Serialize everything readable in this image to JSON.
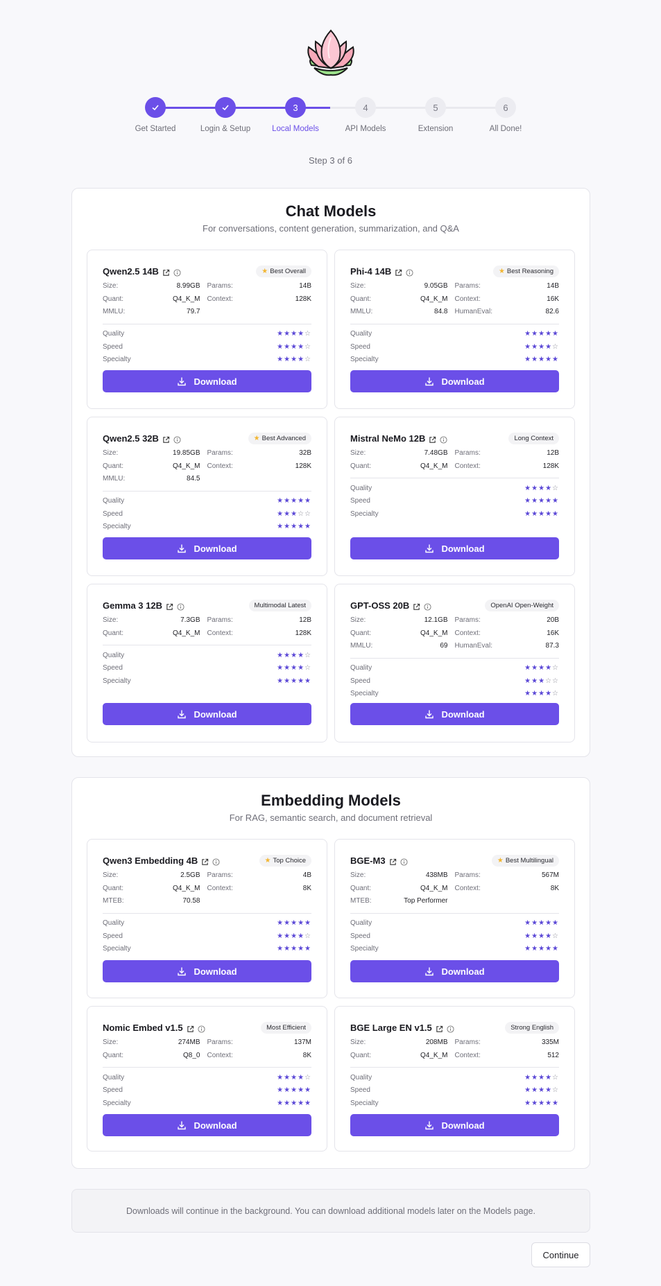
{
  "logo": {
    "icon": "lotus-logo-icon"
  },
  "stepper": {
    "steps": [
      {
        "number": "1",
        "label": "Get Started",
        "state": "done"
      },
      {
        "number": "2",
        "label": "Login & Setup",
        "state": "done"
      },
      {
        "number": "3",
        "label": "Local Models",
        "state": "active"
      },
      {
        "number": "4",
        "label": "API Models",
        "state": "todo"
      },
      {
        "number": "5",
        "label": "Extension",
        "state": "todo"
      },
      {
        "number": "6",
        "label": "All Done!",
        "state": "todo"
      }
    ],
    "step_text": "Step 3 of 6"
  },
  "colors": {
    "accent": "#6b4fe8",
    "star": "#5b48d6",
    "badge_star": "#f2b632"
  },
  "rating_labels": [
    "Quality",
    "Speed",
    "Specialty"
  ],
  "download_label": "Download",
  "chat": {
    "title": "Chat Models",
    "subtitle": "For conversations, content generation, summarization, and Q&A",
    "models": [
      {
        "name": "Qwen2.5 14B",
        "badge": "Best Overall",
        "badge_star": true,
        "specs": [
          [
            "Size:",
            "8.99GB",
            "Params:",
            "14B"
          ],
          [
            "Quant:",
            "Q4_K_M",
            "Context:",
            "128K"
          ],
          [
            "MMLU:",
            "79.7",
            "",
            ""
          ]
        ],
        "ratings": [
          4,
          4,
          4
        ]
      },
      {
        "name": "Phi-4 14B",
        "badge": "Best Reasoning",
        "badge_star": true,
        "specs": [
          [
            "Size:",
            "9.05GB",
            "Params:",
            "14B"
          ],
          [
            "Quant:",
            "Q4_K_M",
            "Context:",
            "16K"
          ],
          [
            "MMLU:",
            "84.8",
            "HumanEval:",
            "82.6"
          ]
        ],
        "ratings": [
          5,
          4,
          5
        ]
      },
      {
        "name": "Qwen2.5 32B",
        "badge": "Best Advanced",
        "badge_star": true,
        "specs": [
          [
            "Size:",
            "19.85GB",
            "Params:",
            "32B"
          ],
          [
            "Quant:",
            "Q4_K_M",
            "Context:",
            "128K"
          ],
          [
            "MMLU:",
            "84.5",
            "",
            ""
          ]
        ],
        "ratings": [
          5,
          3,
          5
        ]
      },
      {
        "name": "Mistral NeMo 12B",
        "badge": "Long Context",
        "badge_star": false,
        "specs": [
          [
            "Size:",
            "7.48GB",
            "Params:",
            "12B"
          ],
          [
            "Quant:",
            "Q4_K_M",
            "Context:",
            "128K"
          ]
        ],
        "ratings": [
          4,
          5,
          5
        ]
      },
      {
        "name": "Gemma 3 12B",
        "badge": "Multimodal Latest",
        "badge_star": false,
        "specs": [
          [
            "Size:",
            "7.3GB",
            "Params:",
            "12B"
          ],
          [
            "Quant:",
            "Q4_K_M",
            "Context:",
            "128K"
          ]
        ],
        "ratings": [
          4,
          4,
          5
        ]
      },
      {
        "name": "GPT-OSS 20B",
        "badge": "OpenAI Open-Weight",
        "badge_star": false,
        "specs": [
          [
            "Size:",
            "12.1GB",
            "Params:",
            "20B"
          ],
          [
            "Quant:",
            "Q4_K_M",
            "Context:",
            "16K"
          ],
          [
            "MMLU:",
            "69",
            "HumanEval:",
            "87.3"
          ]
        ],
        "ratings": [
          4,
          3,
          4
        ]
      }
    ]
  },
  "embedding": {
    "title": "Embedding Models",
    "subtitle": "For RAG, semantic search, and document retrieval",
    "models": [
      {
        "name": "Qwen3 Embedding 4B",
        "badge": "Top Choice",
        "badge_star": true,
        "specs": [
          [
            "Size:",
            "2.5GB",
            "Params:",
            "4B"
          ],
          [
            "Quant:",
            "Q4_K_M",
            "Context:",
            "8K"
          ],
          [
            "MTEB:",
            "70.58",
            "",
            ""
          ]
        ],
        "ratings": [
          5,
          4,
          5
        ]
      },
      {
        "name": "BGE-M3",
        "badge": "Best Multilingual",
        "badge_star": true,
        "specs": [
          [
            "Size:",
            "438MB",
            "Params:",
            "567M"
          ],
          [
            "Quant:",
            "Q4_K_M",
            "Context:",
            "8K"
          ],
          [
            "MTEB:",
            "Top Performer",
            "",
            ""
          ]
        ],
        "ratings": [
          5,
          4,
          5
        ]
      },
      {
        "name": "Nomic Embed v1.5",
        "badge": "Most Efficient",
        "badge_star": false,
        "specs": [
          [
            "Size:",
            "274MB",
            "Params:",
            "137M"
          ],
          [
            "Quant:",
            "Q8_0",
            "Context:",
            "8K"
          ]
        ],
        "ratings": [
          4,
          5,
          5
        ]
      },
      {
        "name": "BGE Large EN v1.5",
        "badge": "Strong English",
        "badge_star": false,
        "specs": [
          [
            "Size:",
            "208MB",
            "Params:",
            "335M"
          ],
          [
            "Quant:",
            "Q4_K_M",
            "Context:",
            "512"
          ]
        ],
        "ratings": [
          4,
          4,
          5
        ]
      }
    ]
  },
  "footer": {
    "note": "Downloads will continue in the background. You can download additional models later on the Models page.",
    "continue_label": "Continue"
  }
}
